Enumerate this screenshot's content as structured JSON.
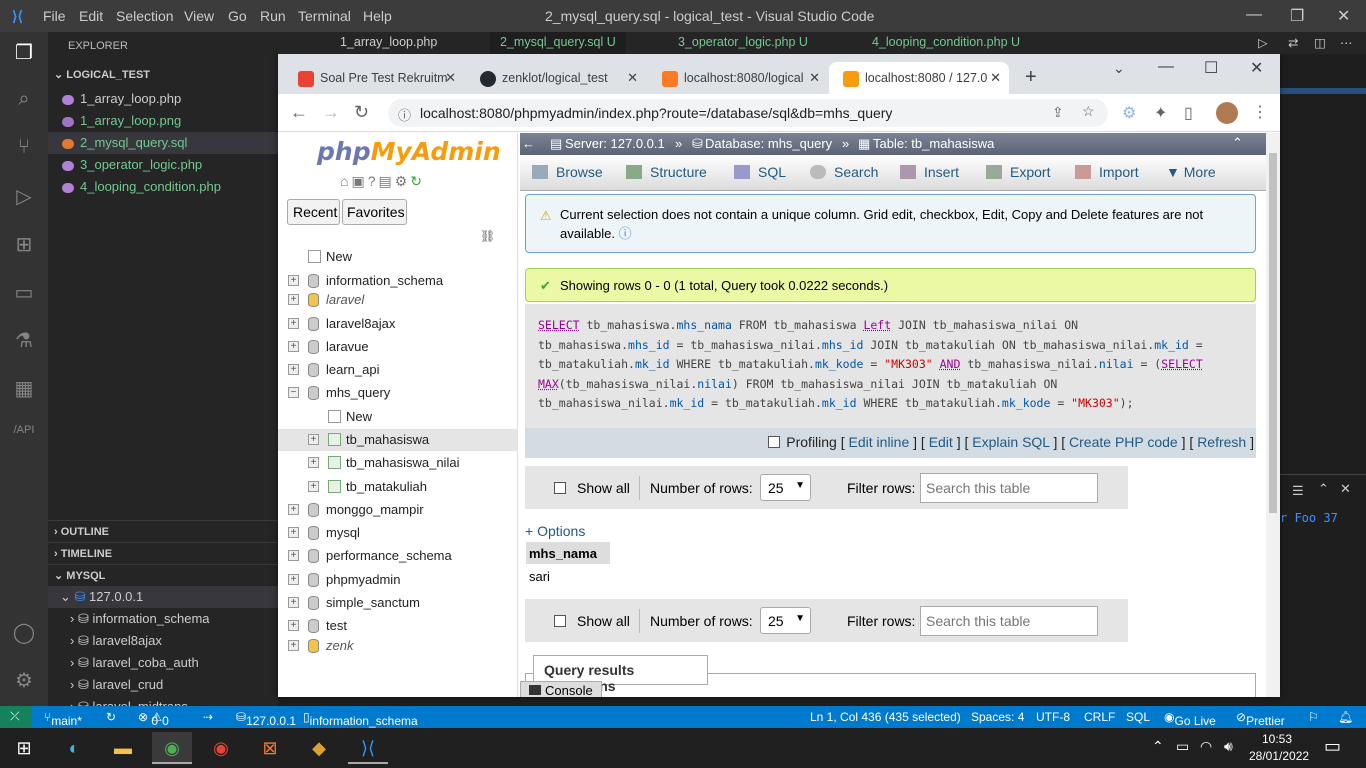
{
  "vscode": {
    "menu": [
      "File",
      "Edit",
      "Selection",
      "View",
      "Go",
      "Run",
      "Terminal",
      "Help"
    ],
    "window_title": "2_mysql_query.sql - logical_test - Visual Studio Code",
    "editor_tabs": [
      "1_array_loop.php",
      "2_mysql_query.sql U",
      "3_operator_logic.php U",
      "4_looping_condition.php U"
    ],
    "explorer_label": "EXPLORER",
    "project": "LOGICAL_TEST",
    "files": [
      {
        "name": "1_array_loop.php",
        "color": "#b180d7"
      },
      {
        "name": "1_array_loop.png",
        "color": "#a074c4"
      },
      {
        "name": "2_mysql_query.sql",
        "color": "#e37933"
      },
      {
        "name": "3_operator_logic.php",
        "color": "#b180d7"
      },
      {
        "name": "4_looping_condition.php",
        "color": "#b180d7"
      }
    ],
    "outline": "OUTLINE",
    "timeline": "TIMELINE",
    "mysql": "MYSQL",
    "mysql_host": "127.0.0.1",
    "mysql_dbs": [
      "information_schema",
      "laravel8ajax",
      "laravel_coba_auth",
      "laravel_crud",
      "laravel_midtrans"
    ],
    "right_snippet": "r Foo 37",
    "status": {
      "branch": "main*",
      "errors": "0",
      "warnings": "0",
      "db": "127.0.0.1",
      "schema": "information_schema",
      "position": "Ln 1, Col 436 (435 selected)",
      "spaces": "Spaces: 4",
      "encoding": "UTF-8",
      "eol": "CRLF",
      "lang": "SQL",
      "live": "Go Live",
      "prettier": "Prettier"
    }
  },
  "chrome": {
    "tabs": [
      "Soal Pre Test Rekruitm",
      "zenklot/logical_test",
      "localhost:8080/logical",
      "localhost:8080 / 127.0"
    ],
    "url": "localhost:8080/phpmyadmin/index.php?route=/database/sql&db=mhs_query"
  },
  "pma": {
    "logo_php": "php",
    "logo_my": "MyAdmin",
    "recent": "Recent",
    "favorites": "Favorites",
    "new": "New",
    "databases": [
      "information_schema",
      "laravel",
      "laravel8ajax",
      "laravue",
      "learn_api",
      "mhs_query",
      "monggo_mampir",
      "mysql",
      "performance_schema",
      "phpmyadmin",
      "simple_sanctum",
      "test",
      "zenk"
    ],
    "tables": [
      "tb_mahasiswa",
      "tb_mahasiswa_nilai",
      "tb_matakuliah"
    ],
    "breadcrumb": {
      "server": "Server: 127.0.0.1",
      "database": "Database: mhs_query",
      "table": "Table: tb_mahasiswa"
    },
    "menu": [
      "Browse",
      "Structure",
      "SQL",
      "Search",
      "Insert",
      "Export",
      "Import",
      "More"
    ],
    "warning": "Current selection does not contain a unique column. Grid edit, checkbox, Edit, Copy and Delete features are not available.",
    "success": "Showing rows 0 - 0 (1 total, Query took 0.0222 seconds.)",
    "profiling": "Profiling",
    "links": [
      "Edit inline",
      "Edit",
      "Explain SQL",
      "Create PHP code",
      "Refresh"
    ],
    "show_all": "Show all",
    "num_rows_label": "Number of rows:",
    "num_rows": "25",
    "filter_label": "Filter rows:",
    "filter_placeholder": "Search this table",
    "options": "+ Options",
    "col_header": "mhs_nama",
    "row_value": "sari",
    "qro": "Query results operations",
    "console": "Console"
  },
  "taskbar": {
    "time": "10:53",
    "date": "28/01/2022"
  }
}
